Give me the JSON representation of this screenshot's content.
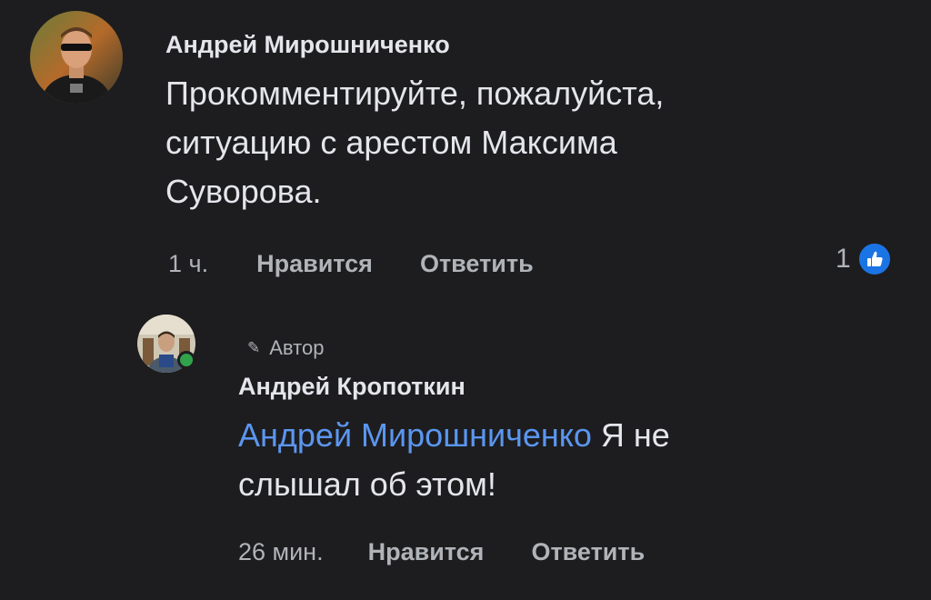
{
  "comment": {
    "author_name": "Андрей Мирошниченко",
    "text": "Прокомментируйте, пожалуйста, ситуацию с арестом Максима Суворова.",
    "time": "1 ч.",
    "like_label": "Нравится",
    "reply_label": "Ответить",
    "reaction_count": "1",
    "reaction_icon": "thumbs-up-icon",
    "reaction_color": "#1b74e4"
  },
  "reply": {
    "badge_label": "Автор",
    "badge_icon": "pencil-icon",
    "author_name": "Андрей Кропоткин",
    "mention": "Андрей Мирошниченко",
    "text": " Я не слышал об этом!",
    "time": "26 мин.",
    "like_label": "Нравится",
    "reply_label": "Ответить",
    "online_status_color": "#31a24c"
  },
  "colors": {
    "background": "#1d1d1f",
    "text": "#e4e6eb",
    "secondary_text": "#b0b3b8",
    "mention": "#5b96f0"
  }
}
